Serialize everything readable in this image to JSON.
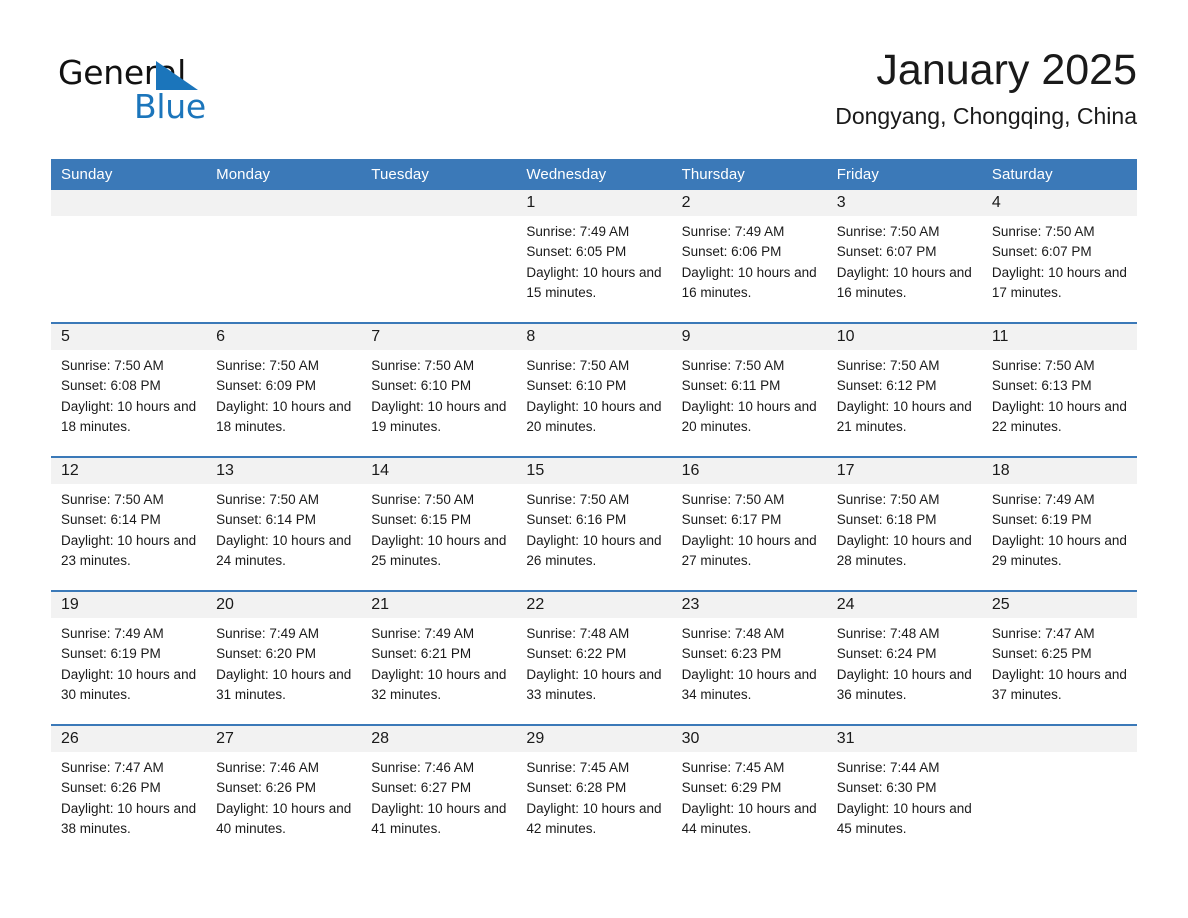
{
  "brand": {
    "name_part1": "General",
    "name_part2": "Blue",
    "accent_color": "#1b75bb"
  },
  "header": {
    "month_title": "January 2025",
    "location": "Dongyang, Chongqing, China",
    "header_bg_color": "#3b79b8",
    "daynum_bg_color": "#f2f2f2"
  },
  "weekday_headers": [
    "Sunday",
    "Monday",
    "Tuesday",
    "Wednesday",
    "Thursday",
    "Friday",
    "Saturday"
  ],
  "labels": {
    "sunrise_prefix": "Sunrise:",
    "sunset_prefix": "Sunset:",
    "daylight_prefix": "Daylight:"
  },
  "weeks": [
    [
      {
        "day": "",
        "sunrise": "",
        "sunset": "",
        "daylight": ""
      },
      {
        "day": "",
        "sunrise": "",
        "sunset": "",
        "daylight": ""
      },
      {
        "day": "",
        "sunrise": "",
        "sunset": "",
        "daylight": ""
      },
      {
        "day": "1",
        "sunrise": "Sunrise: 7:49 AM",
        "sunset": "Sunset: 6:05 PM",
        "daylight": "Daylight: 10 hours and 15 minutes."
      },
      {
        "day": "2",
        "sunrise": "Sunrise: 7:49 AM",
        "sunset": "Sunset: 6:06 PM",
        "daylight": "Daylight: 10 hours and 16 minutes."
      },
      {
        "day": "3",
        "sunrise": "Sunrise: 7:50 AM",
        "sunset": "Sunset: 6:07 PM",
        "daylight": "Daylight: 10 hours and 16 minutes."
      },
      {
        "day": "4",
        "sunrise": "Sunrise: 7:50 AM",
        "sunset": "Sunset: 6:07 PM",
        "daylight": "Daylight: 10 hours and 17 minutes."
      }
    ],
    [
      {
        "day": "5",
        "sunrise": "Sunrise: 7:50 AM",
        "sunset": "Sunset: 6:08 PM",
        "daylight": "Daylight: 10 hours and 18 minutes."
      },
      {
        "day": "6",
        "sunrise": "Sunrise: 7:50 AM",
        "sunset": "Sunset: 6:09 PM",
        "daylight": "Daylight: 10 hours and 18 minutes."
      },
      {
        "day": "7",
        "sunrise": "Sunrise: 7:50 AM",
        "sunset": "Sunset: 6:10 PM",
        "daylight": "Daylight: 10 hours and 19 minutes."
      },
      {
        "day": "8",
        "sunrise": "Sunrise: 7:50 AM",
        "sunset": "Sunset: 6:10 PM",
        "daylight": "Daylight: 10 hours and 20 minutes."
      },
      {
        "day": "9",
        "sunrise": "Sunrise: 7:50 AM",
        "sunset": "Sunset: 6:11 PM",
        "daylight": "Daylight: 10 hours and 20 minutes."
      },
      {
        "day": "10",
        "sunrise": "Sunrise: 7:50 AM",
        "sunset": "Sunset: 6:12 PM",
        "daylight": "Daylight: 10 hours and 21 minutes."
      },
      {
        "day": "11",
        "sunrise": "Sunrise: 7:50 AM",
        "sunset": "Sunset: 6:13 PM",
        "daylight": "Daylight: 10 hours and 22 minutes."
      }
    ],
    [
      {
        "day": "12",
        "sunrise": "Sunrise: 7:50 AM",
        "sunset": "Sunset: 6:14 PM",
        "daylight": "Daylight: 10 hours and 23 minutes."
      },
      {
        "day": "13",
        "sunrise": "Sunrise: 7:50 AM",
        "sunset": "Sunset: 6:14 PM",
        "daylight": "Daylight: 10 hours and 24 minutes."
      },
      {
        "day": "14",
        "sunrise": "Sunrise: 7:50 AM",
        "sunset": "Sunset: 6:15 PM",
        "daylight": "Daylight: 10 hours and 25 minutes."
      },
      {
        "day": "15",
        "sunrise": "Sunrise: 7:50 AM",
        "sunset": "Sunset: 6:16 PM",
        "daylight": "Daylight: 10 hours and 26 minutes."
      },
      {
        "day": "16",
        "sunrise": "Sunrise: 7:50 AM",
        "sunset": "Sunset: 6:17 PM",
        "daylight": "Daylight: 10 hours and 27 minutes."
      },
      {
        "day": "17",
        "sunrise": "Sunrise: 7:50 AM",
        "sunset": "Sunset: 6:18 PM",
        "daylight": "Daylight: 10 hours and 28 minutes."
      },
      {
        "day": "18",
        "sunrise": "Sunrise: 7:49 AM",
        "sunset": "Sunset: 6:19 PM",
        "daylight": "Daylight: 10 hours and 29 minutes."
      }
    ],
    [
      {
        "day": "19",
        "sunrise": "Sunrise: 7:49 AM",
        "sunset": "Sunset: 6:19 PM",
        "daylight": "Daylight: 10 hours and 30 minutes."
      },
      {
        "day": "20",
        "sunrise": "Sunrise: 7:49 AM",
        "sunset": "Sunset: 6:20 PM",
        "daylight": "Daylight: 10 hours and 31 minutes."
      },
      {
        "day": "21",
        "sunrise": "Sunrise: 7:49 AM",
        "sunset": "Sunset: 6:21 PM",
        "daylight": "Daylight: 10 hours and 32 minutes."
      },
      {
        "day": "22",
        "sunrise": "Sunrise: 7:48 AM",
        "sunset": "Sunset: 6:22 PM",
        "daylight": "Daylight: 10 hours and 33 minutes."
      },
      {
        "day": "23",
        "sunrise": "Sunrise: 7:48 AM",
        "sunset": "Sunset: 6:23 PM",
        "daylight": "Daylight: 10 hours and 34 minutes."
      },
      {
        "day": "24",
        "sunrise": "Sunrise: 7:48 AM",
        "sunset": "Sunset: 6:24 PM",
        "daylight": "Daylight: 10 hours and 36 minutes."
      },
      {
        "day": "25",
        "sunrise": "Sunrise: 7:47 AM",
        "sunset": "Sunset: 6:25 PM",
        "daylight": "Daylight: 10 hours and 37 minutes."
      }
    ],
    [
      {
        "day": "26",
        "sunrise": "Sunrise: 7:47 AM",
        "sunset": "Sunset: 6:26 PM",
        "daylight": "Daylight: 10 hours and 38 minutes."
      },
      {
        "day": "27",
        "sunrise": "Sunrise: 7:46 AM",
        "sunset": "Sunset: 6:26 PM",
        "daylight": "Daylight: 10 hours and 40 minutes."
      },
      {
        "day": "28",
        "sunrise": "Sunrise: 7:46 AM",
        "sunset": "Sunset: 6:27 PM",
        "daylight": "Daylight: 10 hours and 41 minutes."
      },
      {
        "day": "29",
        "sunrise": "Sunrise: 7:45 AM",
        "sunset": "Sunset: 6:28 PM",
        "daylight": "Daylight: 10 hours and 42 minutes."
      },
      {
        "day": "30",
        "sunrise": "Sunrise: 7:45 AM",
        "sunset": "Sunset: 6:29 PM",
        "daylight": "Daylight: 10 hours and 44 minutes."
      },
      {
        "day": "31",
        "sunrise": "Sunrise: 7:44 AM",
        "sunset": "Sunset: 6:30 PM",
        "daylight": "Daylight: 10 hours and 45 minutes."
      },
      {
        "day": "",
        "sunrise": "",
        "sunset": "",
        "daylight": ""
      }
    ]
  ]
}
